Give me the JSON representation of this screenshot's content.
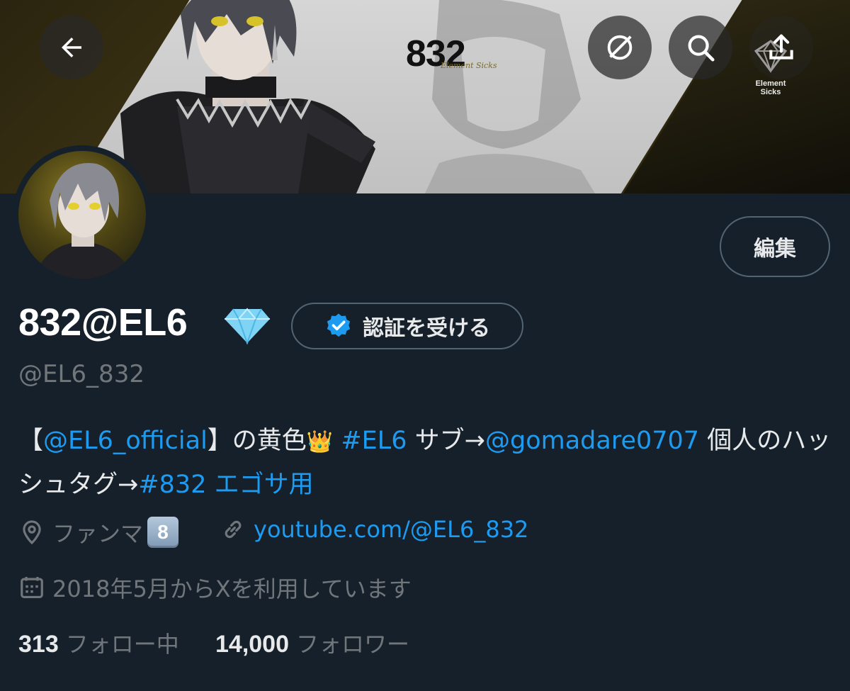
{
  "banner": {
    "title": "832",
    "subtitle": "Element Sicks",
    "brand_logo_text": "Element Sicks"
  },
  "header_buttons": {
    "back_icon": "arrow-left-icon",
    "grok_icon": "slashed-circle-icon",
    "search_icon": "search-icon",
    "share_icon": "share-upload-icon"
  },
  "profile": {
    "edit_label": "編集",
    "display_name": "832@EL6",
    "name_emoji": "gem-icon",
    "verify_label": "認証を受ける",
    "handle": "@EL6_832"
  },
  "bio": {
    "open_bracket": "【",
    "mention_official": "@EL6_official",
    "text_after_official": "】の黄色",
    "crown": "👑",
    "hashtag_el6": "#EL6",
    "text_sub": " サブ→",
    "mention_gomadare": "@gomadare0707",
    "text_personal": " 個人のハッシュタグ→",
    "hashtag_832": "#832",
    "text_egosa": " エゴサ用"
  },
  "meta": {
    "location": "ファンマ",
    "location_keycap": "8",
    "website": "youtube.com/@EL6_832",
    "joined": "2018年5月からXを利用しています"
  },
  "stats": {
    "following_count": "313",
    "following_label": "フォロー中",
    "followers_count": "14,000",
    "followers_label": "フォロワー"
  },
  "colors": {
    "background": "#15202b",
    "link": "#1d9bf0",
    "secondary_text": "#71767b",
    "primary_text": "#e7e9ea",
    "verified_badge": "#1d9bf0"
  }
}
